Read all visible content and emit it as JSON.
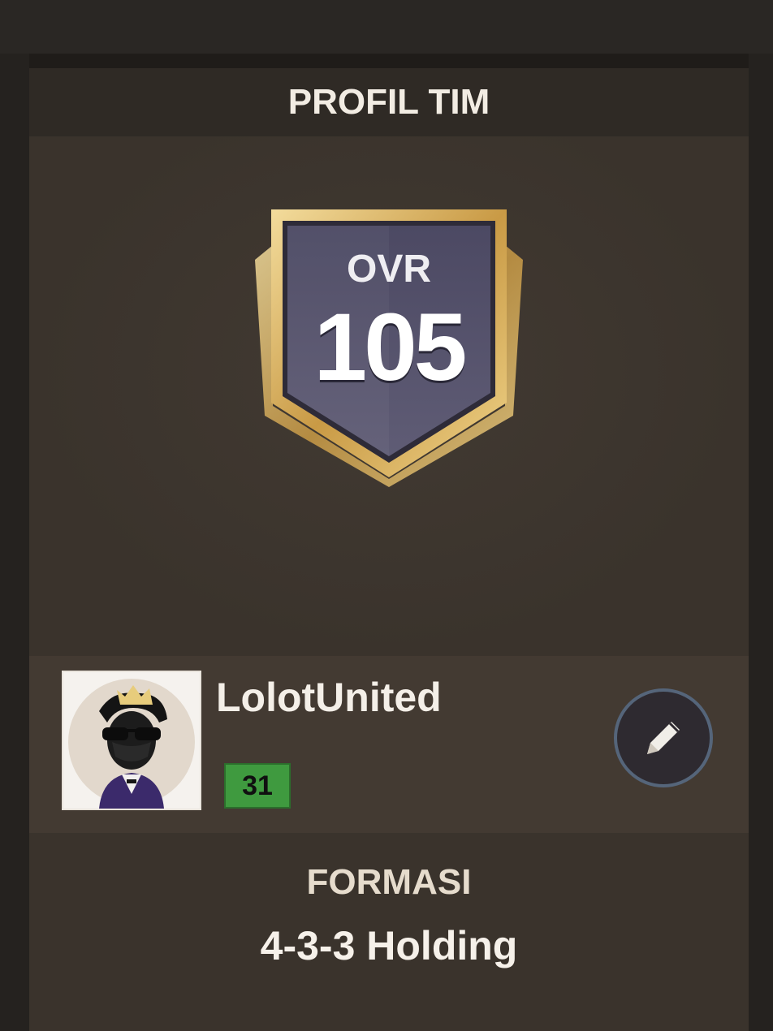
{
  "header": {
    "title": "PROFIL TIM"
  },
  "rating": {
    "label": "OVR",
    "value": "105"
  },
  "team": {
    "name": "LolotUnited",
    "level": "31"
  },
  "formation": {
    "label": "FORMASI",
    "value": "4-3-3 Holding"
  },
  "icons": {
    "badge": "shield-badge-icon",
    "avatar": "avatar-icon",
    "edit": "pencil-icon"
  },
  "colors": {
    "panel": "#3a332c",
    "badge_gold": "#d9b366",
    "badge_inner": "#55526a",
    "level_green": "#3f9a3f",
    "edit_ring": "#55657a"
  }
}
